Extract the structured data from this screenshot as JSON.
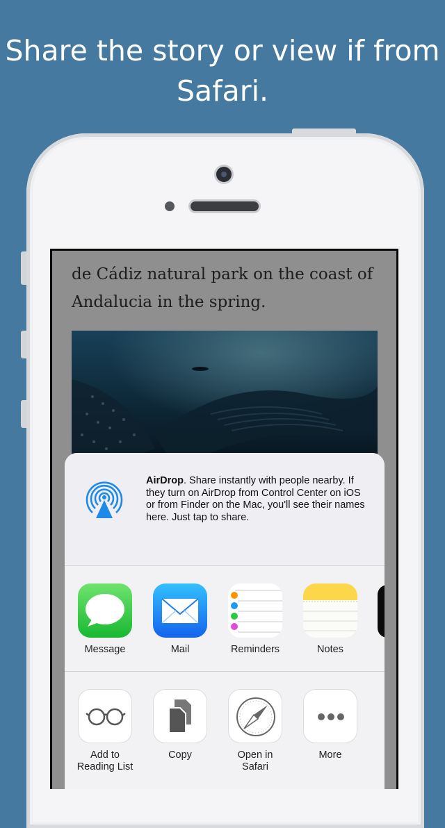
{
  "headline": "Share the story or view if from Safari.",
  "article": {
    "text": "de Cádiz natural park on the coast of Andalucia in the spring."
  },
  "airdrop": {
    "title": "AirDrop",
    "body": ". Share instantly with people nearby. If they turn on AirDrop from Control Center on iOS or from Finder on the Mac, you'll see their names here. Just tap to share."
  },
  "share_apps": [
    {
      "label": "Message",
      "icon": "messages-icon"
    },
    {
      "label": "Mail",
      "icon": "mail-icon"
    },
    {
      "label": "Reminders",
      "icon": "reminders-icon"
    },
    {
      "label": "Notes",
      "icon": "notes-icon"
    }
  ],
  "actions": [
    {
      "label": "Add to Reading List",
      "icon": "glasses-icon"
    },
    {
      "label": "Copy",
      "icon": "copy-icon"
    },
    {
      "label": "Open in Safari",
      "icon": "compass-icon"
    },
    {
      "label": "More",
      "icon": "more-icon"
    }
  ],
  "colors": {
    "background": "#46799f",
    "airdrop_blue": "#1e8ae8",
    "messages_green": "#35c93f",
    "mail_blue": "#1c8ef5",
    "notes_yellow": "#fdd74a"
  }
}
